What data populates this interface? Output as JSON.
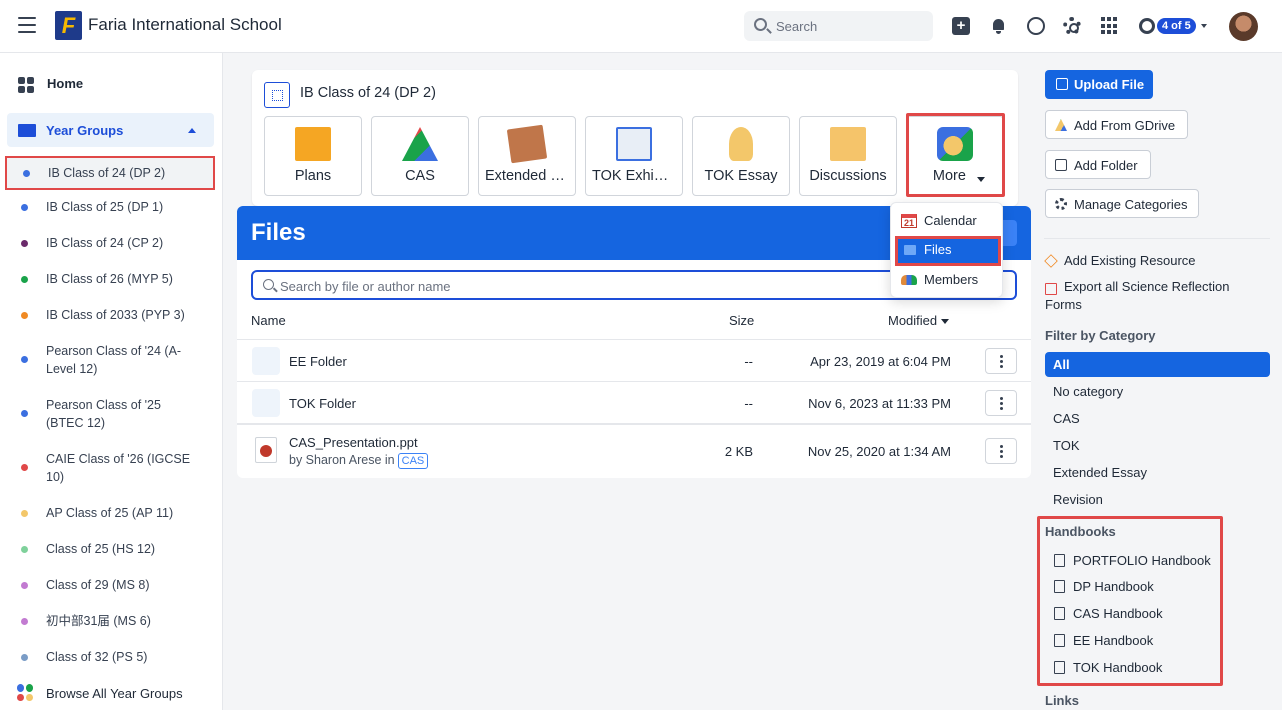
{
  "header": {
    "school_name": "Faria International School",
    "logo_letter": "F",
    "search_placeholder": "Search",
    "badge": "4 of 5",
    "icons": [
      "menu-icon",
      "add-icon",
      "bell-icon",
      "chat-icon",
      "gear-icon",
      "apps-icon",
      "help-icon",
      "avatar"
    ]
  },
  "sidebar": {
    "home": "Home",
    "year_groups": "Year Groups",
    "items": [
      {
        "label": "IB Class of 24 (DP 2)",
        "color": "#3b6fe0"
      },
      {
        "label": "IB Class of 25 (DP 1)",
        "color": "#3b6fe0"
      },
      {
        "label": "IB Class of 24 (CP 2)",
        "color": "#6b2a6b"
      },
      {
        "label": "IB Class of 26 (MYP 5)",
        "color": "#1aa34a"
      },
      {
        "label": "IB Class of 2033 (PYP 3)",
        "color": "#f08a24"
      },
      {
        "label": "Pearson Class of '24 (A-Level 12)",
        "color": "#3b6fe0"
      },
      {
        "label": "Pearson Class of '25 (BTEC 12)",
        "color": "#3b6fe0"
      },
      {
        "label": "CAIE Class of '26 (IGCSE 10)",
        "color": "#e04848"
      },
      {
        "label": "AP Class of 25 (AP 11)",
        "color": "#f3c76a"
      },
      {
        "label": "Class of 25 (HS 12)",
        "color": "#7fd19b"
      },
      {
        "label": "Class of 29 (MS 8)",
        "color": "#c27bd1"
      },
      {
        "label": "初中部31届 (MS 6)",
        "color": "#c27bd1"
      },
      {
        "label": "Class of 32 (PS 5)",
        "color": "#7a9cc6"
      }
    ],
    "browse": "Browse All Year Groups"
  },
  "class_card": {
    "title": "IB Class of 24 (DP 2)",
    "tiles": [
      {
        "label": "Plans",
        "icon": "plans-icon"
      },
      {
        "label": "CAS",
        "icon": "cas-icon"
      },
      {
        "label": "Extended Essay",
        "icon": "extended-essay-icon"
      },
      {
        "label": "TOK Exhibition",
        "icon": "tok-exhibition-icon"
      },
      {
        "label": "TOK Essay",
        "icon": "tok-essay-icon"
      },
      {
        "label": "Discussions",
        "icon": "discussions-icon"
      },
      {
        "label": "More",
        "icon": "more-icon"
      }
    ]
  },
  "more_menu": {
    "items": [
      {
        "label": "Calendar",
        "icon": "calendar-icon"
      },
      {
        "label": "Files",
        "icon": "folder-icon"
      },
      {
        "label": "Members",
        "icon": "members-icon"
      }
    ],
    "calendar_day": "21"
  },
  "files": {
    "title": "Files",
    "search_placeholder": "Search by file or author name",
    "columns": {
      "name": "Name",
      "size": "Size",
      "modified": "Modified"
    },
    "rows": [
      {
        "name": "EE Folder",
        "size": "--",
        "modified": "Apr 23, 2019 at 6:04 PM"
      },
      {
        "name": "TOK Folder",
        "size": "--",
        "modified": "Nov 6, 2023 at 11:33 PM"
      },
      {
        "name": "CAS_Presentation.ppt",
        "by": "by Sharon Arese in",
        "tag": "CAS",
        "size": "2 KB",
        "modified": "Nov 25, 2020 at 1:34 AM"
      }
    ]
  },
  "right": {
    "upload": "Upload File",
    "gdrive": "Add From GDrive",
    "add_folder": "Add Folder",
    "manage": "Manage Categories",
    "add_existing": "Add Existing Resource",
    "export": "Export all Science Reflection Forms",
    "filter_title": "Filter by Category",
    "categories": [
      "All",
      "No category",
      "CAS",
      "TOK",
      "Extended Essay",
      "Revision"
    ],
    "handbooks_title": "Handbooks",
    "handbooks": [
      "PORTFOLIO Handbook",
      "DP Handbook",
      "CAS Handbook",
      "EE Handbook",
      "TOK Handbook"
    ],
    "links_title": "Links"
  },
  "colors": {
    "accent": "#1565e0",
    "highlight": "#e04848"
  }
}
